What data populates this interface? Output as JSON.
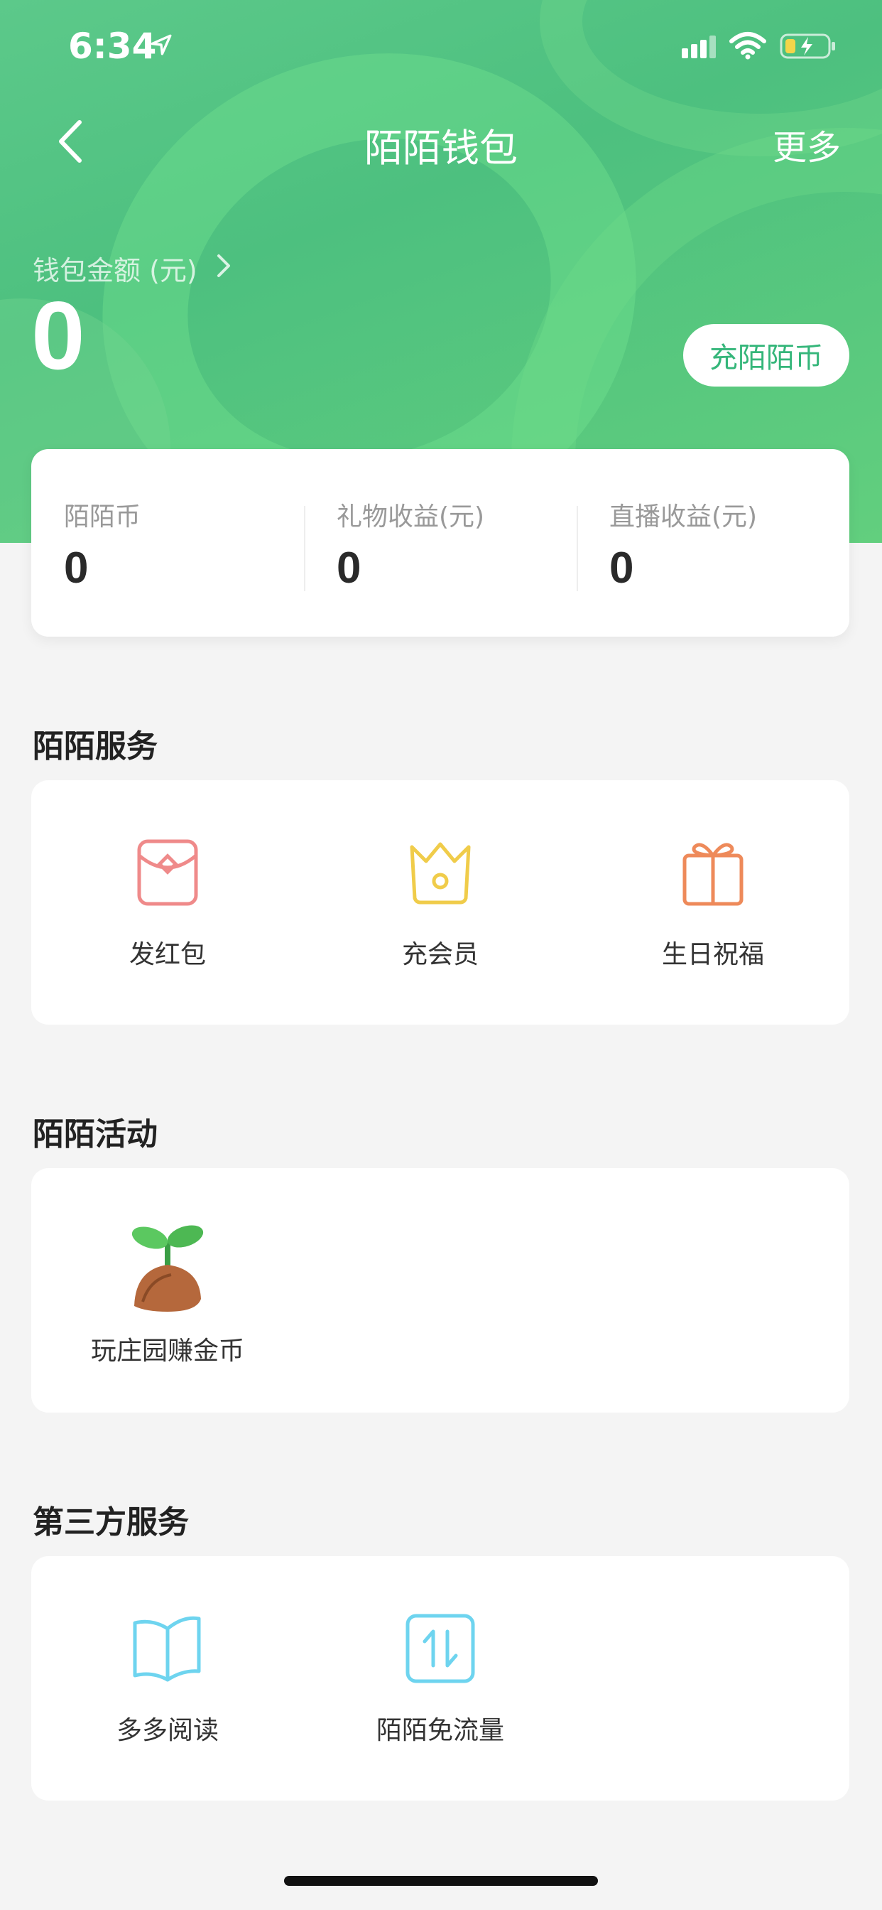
{
  "status_bar": {
    "time": "6:34"
  },
  "nav": {
    "title": "陌陌钱包",
    "more": "更多"
  },
  "wallet": {
    "label": "钱包金额 (元)",
    "amount": "0",
    "recharge_button": "充陌陌币"
  },
  "balances": [
    {
      "label": "陌陌币",
      "value": "0"
    },
    {
      "label": "礼物收益(元)",
      "value": "0"
    },
    {
      "label": "直播收益(元)",
      "value": "0"
    }
  ],
  "services": {
    "title": "陌陌服务",
    "items": [
      {
        "label": "发红包",
        "icon": "red-envelope-icon",
        "color": "#ef8a8a"
      },
      {
        "label": "充会员",
        "icon": "crown-icon",
        "color": "#f0cc4a"
      },
      {
        "label": "生日祝福",
        "icon": "gift-icon",
        "color": "#ee8a5a"
      }
    ]
  },
  "activities": {
    "title": "陌陌活动",
    "items": [
      {
        "label": "玩庄园赚金币",
        "icon": "sprout-icon"
      }
    ]
  },
  "third_party": {
    "title": "第三方服务",
    "items": [
      {
        "label": "多多阅读",
        "icon": "open-book-icon",
        "color": "#6ed4ef"
      },
      {
        "label": "陌陌免流量",
        "icon": "data-transfer-icon",
        "color": "#6ed4ef"
      }
    ]
  },
  "colors": {
    "brand_green": "#4dc07f",
    "accent_text": "#35b67a"
  }
}
